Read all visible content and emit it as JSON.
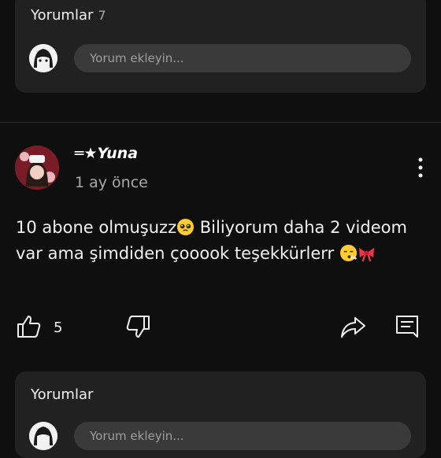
{
  "comments_card_top": {
    "title": "Yorumlar",
    "count": "7",
    "input_placeholder": "Yorum ekleyin..."
  },
  "post": {
    "author": "═★Yuna",
    "time": "1 ay önce",
    "text_part1": "10 abone olmuşuzz",
    "text_part2": " Biliyorum daha 2 videom var ama şimdiden çooook teşekkürlerr ",
    "like_count": "5",
    "icons": [
      "more-vert-icon",
      "like-icon",
      "dislike-icon",
      "share-icon",
      "comment-icon"
    ]
  },
  "comments_card_bottom": {
    "title": "Yorumlar",
    "input_placeholder": "Yorum ekleyin..."
  }
}
